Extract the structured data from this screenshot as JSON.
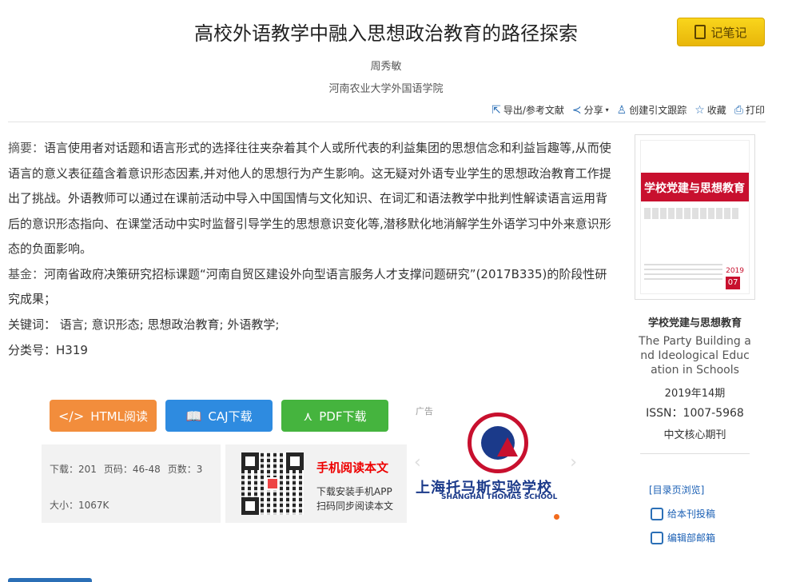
{
  "article": {
    "title": "高校外语教学中融入思想政治教育的路径探索",
    "author": "周秀敏",
    "organization": "河南农业大学外国语学院"
  },
  "note_button": {
    "label": "记笔记"
  },
  "toolbar": {
    "export": "导出/参考文献",
    "share": "分享",
    "track": "创建引文跟踪",
    "favorite": "收藏",
    "print": "打印"
  },
  "abstract": {
    "label": "摘要：",
    "text": "语言使用者对话题和语言形式的选择往往夹杂着其个人或所代表的利益集团的思想信念和利益旨趣等,从而使语言的意义表征蕴含着意识形态因素,并对他人的思想行为产生影响。这无疑对外语专业学生的思想政治教育工作提出了挑战。外语教师可以通过在课前活动中导入中国国情与文化知识、在词汇和语法教学中批判性解读语言运用背后的意识形态指向、在课堂活动中实时监督引导学生的思想意识变化等,潜移默化地消解学生外语学习中外来意识形态的负面影响。"
  },
  "fund": {
    "label": "基金：",
    "text": "河南省政府决策研究招标课题“河南自贸区建设外向型语言服务人才支撑问题研究”(2017B335)的阶段性研究成果；"
  },
  "keywords": {
    "label": "关键词：",
    "items": [
      "语言;",
      "意识形态;",
      "思想政治教育;",
      "外语教学;"
    ]
  },
  "classification": {
    "label": "分类号：",
    "value": "H319"
  },
  "downloads": {
    "html": "HTML阅读",
    "caj": "CAJ下载",
    "pdf": "PDF下载"
  },
  "stats": {
    "downloads": "下载：201",
    "pages": "页码：46-48",
    "page_count": "页数：3",
    "size": "大小：1067K"
  },
  "mobile": {
    "title": "手机阅读本文",
    "line1": "下载安装手机APP",
    "line2": "扫码同步阅读本文"
  },
  "ad": {
    "label": "广告",
    "name_cn": "上海托马斯实验学校",
    "name_en": "SHANGHAI THOMAS SCHOOL"
  },
  "journal": {
    "cover_title": "学校党建与思想教育",
    "cover_year": "2019",
    "cover_issue": "07",
    "name_cn": "学校党建与思想教育",
    "name_en_1": "The Party Building a",
    "name_en_2": "nd Ideological Educ",
    "name_en_3": "ation in Schools",
    "issue": "2019年14期",
    "issn": "ISSN：1007-5968",
    "core": "中文核心期刊",
    "toc": "[目录页浏览]",
    "submit": "给本刊投稿",
    "editor_mail": "编辑部邮箱"
  },
  "colors": {
    "note_yellow": "#f0c419",
    "html_orange": "#f28d3c",
    "caj_blue": "#2e8be0",
    "pdf_green": "#45b43e",
    "link_blue": "#1a5fb4",
    "cover_red": "#c8102e"
  }
}
